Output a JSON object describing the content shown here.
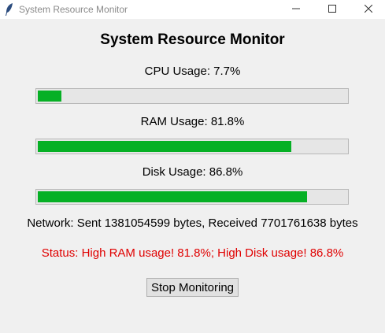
{
  "window": {
    "title": "System Resource Monitor",
    "icon": "feather-icon",
    "controls": [
      "minimize-icon",
      "maximize-icon",
      "close-icon"
    ]
  },
  "main": {
    "heading": "System Resource Monitor",
    "cpu": {
      "label": "CPU Usage: 7.7%",
      "percent": 7.7
    },
    "ram": {
      "label": "RAM Usage: 81.8%",
      "percent": 81.8
    },
    "disk": {
      "label": "Disk Usage: 86.8%",
      "percent": 86.8
    },
    "network_text": "Network: Sent 1381054599 bytes, Received 7701761638 bytes",
    "status_text": "Status: High RAM usage! 81.8%; High Disk usage! 86.8%",
    "stop_button_label": "Stop Monitoring"
  },
  "colors": {
    "progress_fill": "#06b025",
    "status_text": "#e00000",
    "background": "#f0f0f0"
  }
}
